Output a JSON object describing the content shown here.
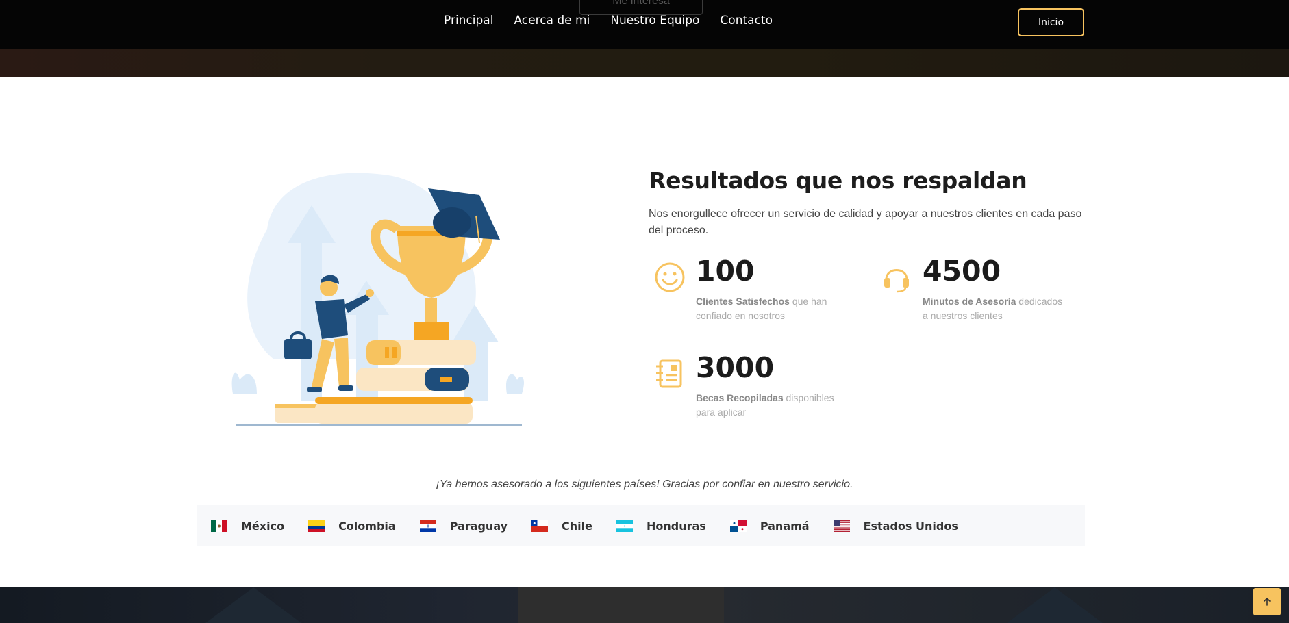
{
  "nav": {
    "ghost_button": "Me interesa",
    "links": [
      "Principal",
      "Acerca de mi",
      "Nuestro Equipo",
      "Contacto"
    ],
    "cta": "Inicio"
  },
  "results": {
    "title": "Resultados que nos respaldan",
    "lead": "Nos enorgullece ofrecer un servicio de calidad y apoyar a nuestros clientes en cada paso del proceso.",
    "stats": [
      {
        "icon": "smiley-icon",
        "number": "100",
        "label": "Clientes Satisfechos",
        "text": "que han confiado en nosotros"
      },
      {
        "icon": "headset-icon",
        "number": "4500",
        "label": "Minutos de Asesoría",
        "text": "dedicados a nuestros clientes"
      },
      {
        "icon": "report-icon",
        "number": "3000",
        "label": "Becas Recopiladas",
        "text": "disponibles para aplicar"
      }
    ]
  },
  "countries": {
    "note": "¡Ya hemos asesorado a los siguientes países! Gracias por confiar en nuestro servicio.",
    "items": [
      {
        "flag": "mexico-flag-icon",
        "name": "México"
      },
      {
        "flag": "colombia-flag-icon",
        "name": "Colombia"
      },
      {
        "flag": "paraguay-flag-icon",
        "name": "Paraguay"
      },
      {
        "flag": "chile-flag-icon",
        "name": "Chile"
      },
      {
        "flag": "honduras-flag-icon",
        "name": "Honduras"
      },
      {
        "flag": "panama-flag-icon",
        "name": "Panamá"
      },
      {
        "flag": "usa-flag-icon",
        "name": "Estados Unidos"
      }
    ]
  },
  "colors": {
    "accent": "#f7c35f",
    "navbar": "#050505",
    "text_dark": "#1d1d1d"
  }
}
